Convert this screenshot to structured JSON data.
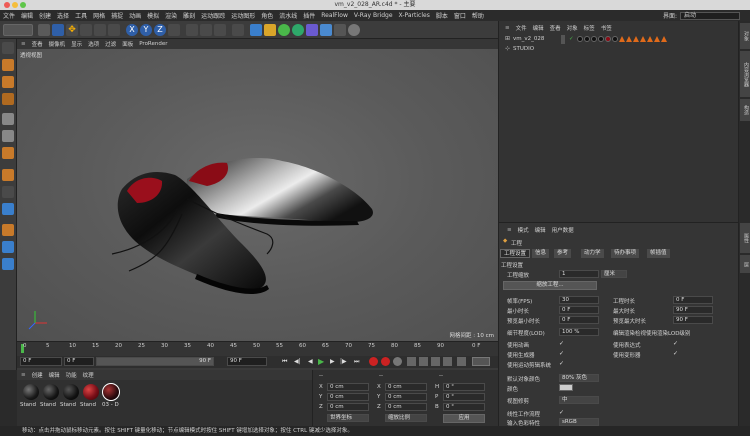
{
  "window": {
    "title": "vm_v2_028_AR.c4d * - 主要"
  },
  "menubar": {
    "items": [
      "文件",
      "编辑",
      "创建",
      "选择",
      "工具",
      "网格",
      "捕捉",
      "动画",
      "模拟",
      "渲染",
      "雕刻",
      "运动跟踪",
      "运动图形",
      "角色",
      "流水线",
      "插件",
      "RealFlow",
      "V-Ray Bridge",
      "X-Particles",
      "脚本",
      "窗口",
      "帮助"
    ],
    "layout_label": "界面:",
    "layout_value": "启动"
  },
  "toolbar": {
    "axis_x": "X",
    "axis_y": "Y",
    "axis_z": "Z"
  },
  "viewport": {
    "menu": [
      "查看",
      "摄像机",
      "显示",
      "选项",
      "过滤",
      "面板",
      "ProRender"
    ],
    "label": "透视视图",
    "grid_distance": "网格间距 : 10 cm"
  },
  "timeline": {
    "ticks": [
      "0",
      "5",
      "10",
      "15",
      "20",
      "25",
      "30",
      "35",
      "40",
      "45",
      "50",
      "55",
      "60",
      "65",
      "70",
      "75",
      "80",
      "85",
      "90"
    ],
    "end_label": "0 F",
    "start_field": "0 F",
    "current_field": "0 F",
    "range_end": "90 F",
    "max_field": "90 F"
  },
  "materials": {
    "menu": [
      "创建",
      "编辑",
      "功能",
      "纹理"
    ],
    "items": [
      {
        "label": "Stand",
        "color": "#1a1a1a"
      },
      {
        "label": "Stand",
        "color": "#151515"
      },
      {
        "label": "Stand",
        "color": "#121212"
      },
      {
        "label": "Stand",
        "color": "#7a0f18"
      },
      {
        "label": "03 - D",
        "color": "#2a0a0d"
      }
    ]
  },
  "coordinates": {
    "header": [
      "--",
      "--",
      "--"
    ],
    "rows": [
      {
        "axis": "X",
        "pos": "0 cm",
        "axis2": "X",
        "size": "0 cm",
        "axis3": "H",
        "rot": "0 °"
      },
      {
        "axis": "Y",
        "pos": "0 cm",
        "axis2": "Y",
        "size": "0 cm",
        "axis3": "P",
        "rot": "0 °"
      },
      {
        "axis": "Z",
        "pos": "0 cm",
        "axis2": "Z",
        "size": "0 cm",
        "axis3": "B",
        "rot": "0 °"
      }
    ],
    "mode1": "世界坐标",
    "mode2": "缩放比例",
    "apply": "应用"
  },
  "objects": {
    "menu": [
      "文件",
      "编辑",
      "查看",
      "对象",
      "标签",
      "书签"
    ],
    "items": [
      {
        "name": "vm_v2_028"
      },
      {
        "name": "STUDIO"
      }
    ]
  },
  "attributes": {
    "menu": [
      "模式",
      "编辑",
      "用户数据"
    ],
    "object_label": "工程",
    "tabs": [
      "工程设置",
      "信息",
      "参考",
      "动力学",
      "待办事项",
      "帧插值"
    ],
    "section": "工程设置",
    "scale_label": "工程缩放",
    "scale_value": "1",
    "scale_unit": "厘米",
    "scale_button": "缩放工程...",
    "fps_label": "帧率(FPS)",
    "fps_value": "30",
    "project_time_label": "工程时长",
    "project_time_value": "0 F",
    "min_time_label": "最小时长",
    "min_time_value": "0 F",
    "max_time_label": "最大时长",
    "max_time_value": "90 F",
    "preview_min_label": "预览最小时长",
    "preview_min_value": "0 F",
    "preview_max_label": "预览最大时长",
    "preview_max_value": "90 F",
    "lod_label": "细节程度(LOD)",
    "lod_value": "100 %",
    "lod_render_label": "编辑渲染检视使用渲染LOD级别",
    "use_anim_label": "使用动画",
    "use_expr_label": "使用表达式",
    "use_gen_label": "使用生成器",
    "use_deform_label": "使用变形器",
    "use_motion_label": "使用运动剪辑系统",
    "default_color_label": "默认对象颜色",
    "default_color_value": "80% 灰色",
    "color_label": "颜色",
    "view_clip_label": "视图修剪",
    "view_clip_value": "中",
    "linear_label": "线性工作流程",
    "input_color_label": "输入色彩特性",
    "input_color_value": "sRGB"
  },
  "right_tabs": [
    "对象",
    "内容浏览器",
    "构造",
    "属性",
    "层"
  ],
  "statusbar": {
    "text": "移动：点击并拖动鼠标移动元素。按住 SHIFT 键量化移动；节点编辑模式时按住 SHIFT 键增加选择对象；按住 CTRL 键减少选择对象。"
  },
  "colors": {
    "accent_blue": "#4a7fd4",
    "selection_blue": "#2f5fa8",
    "viewport_bg": "#5b5b5b"
  }
}
